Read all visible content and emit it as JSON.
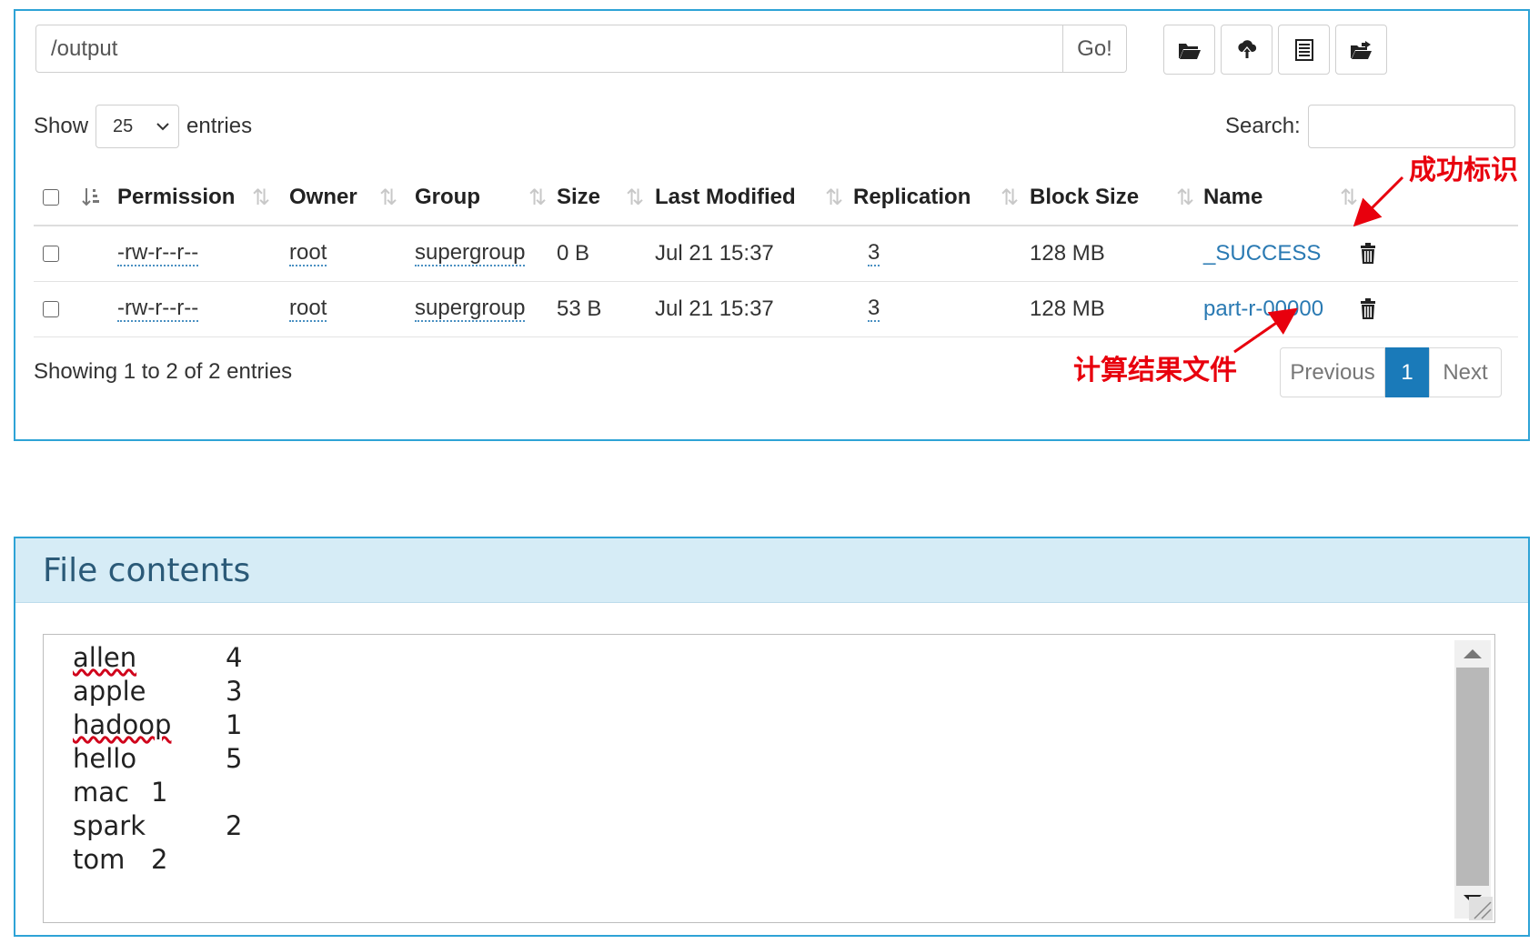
{
  "browser": {
    "path_value": "/output",
    "go_label": "Go!",
    "toolbar": [
      "folder-open-icon",
      "upload-icon",
      "list-icon",
      "move-icon"
    ]
  },
  "controls": {
    "show_label": "Show",
    "entries_value": "25",
    "entries_label": "entries",
    "search_label": "Search:"
  },
  "table": {
    "headers": [
      "Permission",
      "Owner",
      "Group",
      "Size",
      "Last Modified",
      "Replication",
      "Block Size",
      "Name"
    ],
    "rows": [
      {
        "permission": "-rw-r--r--",
        "owner": "root",
        "group": "supergroup",
        "size": "0 B",
        "modified": "Jul 21 15:37",
        "replication": "3",
        "block_size": "128 MB",
        "name": "_SUCCESS"
      },
      {
        "permission": "-rw-r--r--",
        "owner": "root",
        "group": "supergroup",
        "size": "53 B",
        "modified": "Jul 21 15:37",
        "replication": "3",
        "block_size": "128 MB",
        "name": "part-r-00000"
      }
    ]
  },
  "footer": {
    "showing": "Showing 1 to 2 of 2 entries",
    "prev": "Previous",
    "page": "1",
    "next": "Next"
  },
  "annotations": {
    "success": "成功标识",
    "result": "计算结果文件",
    "color": "#e8000d"
  },
  "file_contents": {
    "title": "File contents",
    "lines": [
      {
        "word": "allen",
        "count": "4"
      },
      {
        "word": "apple",
        "count": "3"
      },
      {
        "word": "hadoop",
        "count": "1"
      },
      {
        "word": "hello",
        "count": "5"
      },
      {
        "word": "mac",
        "count": "1"
      },
      {
        "word": "spark",
        "count": "2"
      },
      {
        "word": "tom",
        "count": "2"
      }
    ]
  }
}
